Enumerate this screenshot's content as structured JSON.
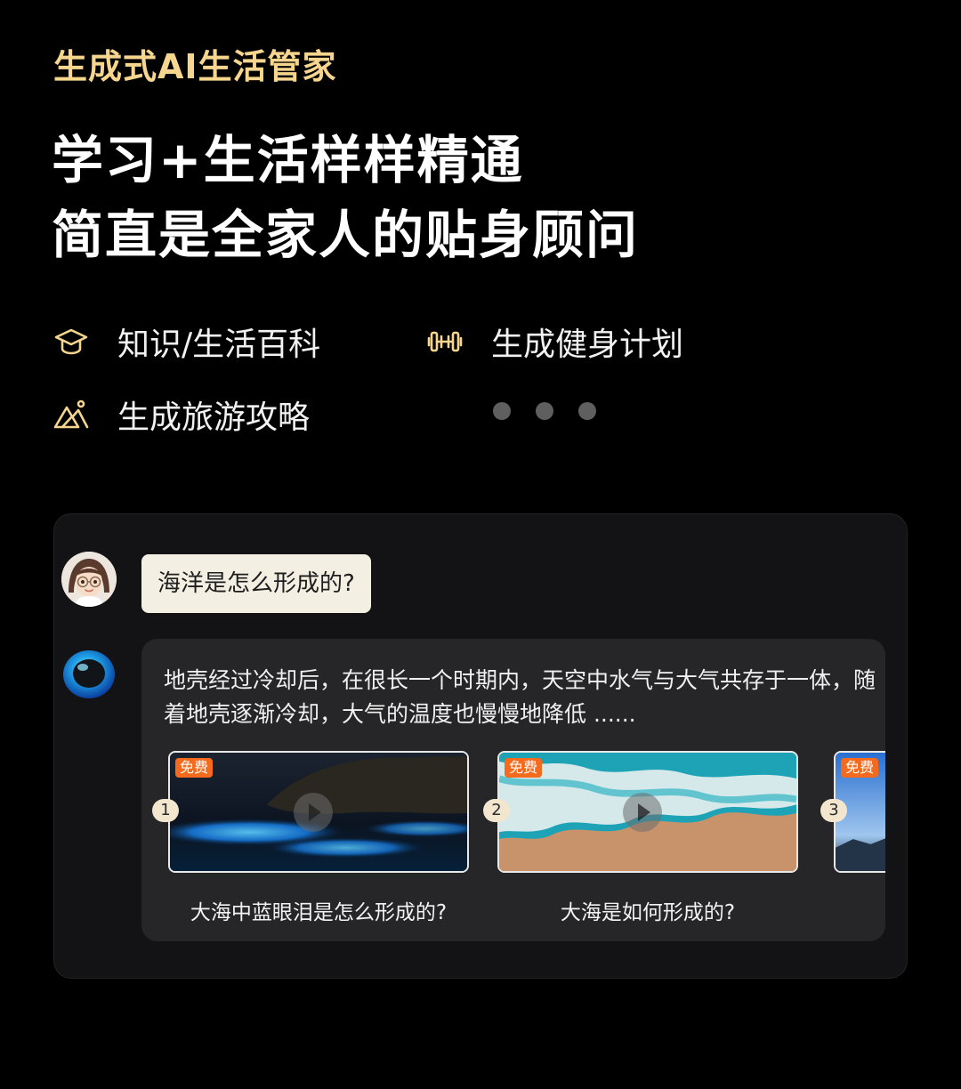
{
  "eyebrow": "生成式AI生活管家",
  "headline": {
    "line1": "学习+生活样样精通",
    "line2": "简直是全家人的贴身顾问"
  },
  "features": [
    {
      "label": "知识/生活百科",
      "icon": "graduation-cap-icon"
    },
    {
      "label": "生成健身计划",
      "icon": "dumbbell-icon"
    },
    {
      "label": "生成旅游攻略",
      "icon": "mountain-icon"
    }
  ],
  "colors": {
    "accent_gold": "#f6d58e",
    "free_badge": "#f56a1c",
    "user_bubble": "#f3efe2",
    "bot_bubble": "#262628"
  },
  "chat": {
    "user_message": "海洋是怎么形成的?",
    "bot_message": "地壳经过冷却后，在很长一个时期内，天空中水气与大气共存于一体，随着地壳逐渐冷却，大气的温度也慢慢地降低 ......",
    "videos": [
      {
        "number": "1",
        "badge": "免费",
        "caption": "大海中蓝眼泪是怎么形成的?"
      },
      {
        "number": "2",
        "badge": "免费",
        "caption": "大海是如何形成的?"
      },
      {
        "number": "3",
        "badge": "免费",
        "caption": ""
      }
    ]
  }
}
